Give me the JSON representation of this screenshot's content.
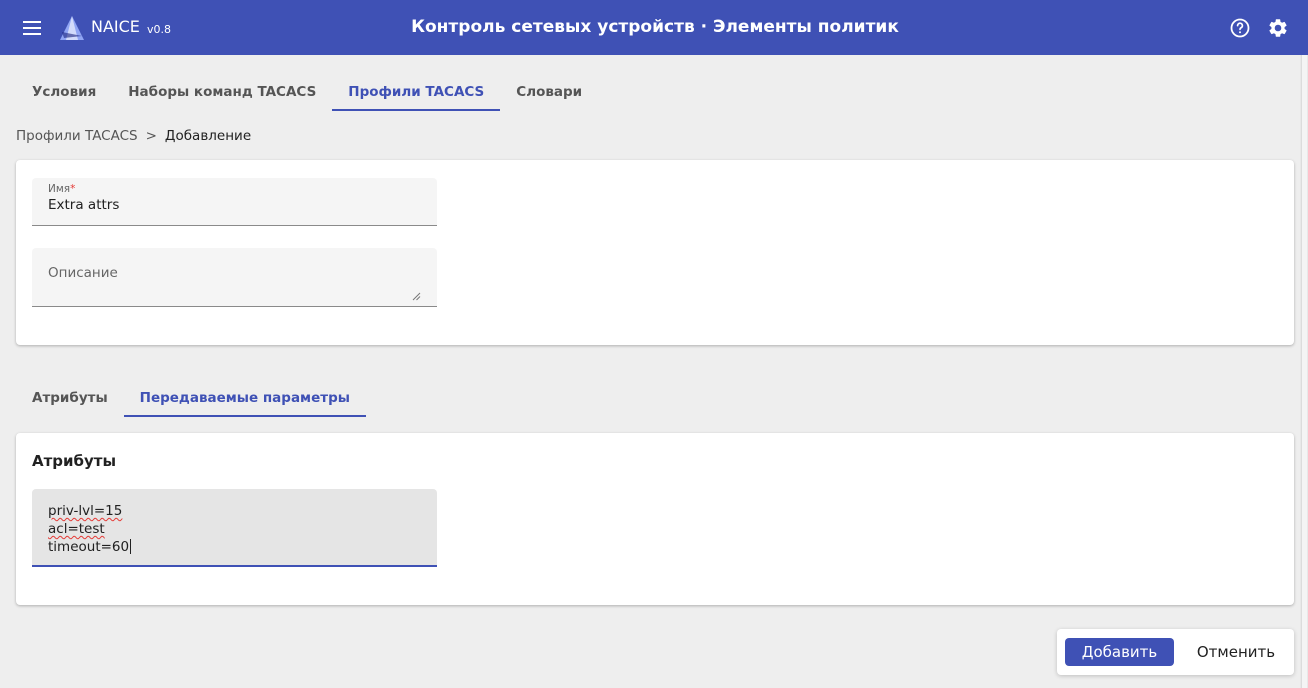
{
  "header": {
    "app_name": "NAICE",
    "version": "v0.8",
    "title": "Контроль сетевых устройств · Элементы политик",
    "menu_icon": "menu-icon",
    "help_icon": "help-circle-icon",
    "settings_icon": "gear-icon",
    "color": "#3f51b5"
  },
  "tabs": [
    {
      "label": "Условия",
      "active": false
    },
    {
      "label": "Наборы команд TACACS",
      "active": false
    },
    {
      "label": "Профили TACACS",
      "active": true
    },
    {
      "label": "Словари",
      "active": false
    }
  ],
  "breadcrumb": {
    "parent": "Профили TACACS",
    "separator": ">",
    "current": "Добавление"
  },
  "form": {
    "name_label": "Имя",
    "name_required_mark": "*",
    "name_value": "Extra attrs",
    "description_placeholder": "Описание"
  },
  "subtabs": [
    {
      "label": "Атрибуты",
      "active": false
    },
    {
      "label": "Передаваемые параметры",
      "active": true
    }
  ],
  "attributes": {
    "title": "Атрибуты",
    "lines": [
      "priv-lvl=15",
      "acl=test",
      "timeout=60"
    ]
  },
  "actions": {
    "add_label": "Добавить",
    "cancel_label": "Отменить"
  }
}
